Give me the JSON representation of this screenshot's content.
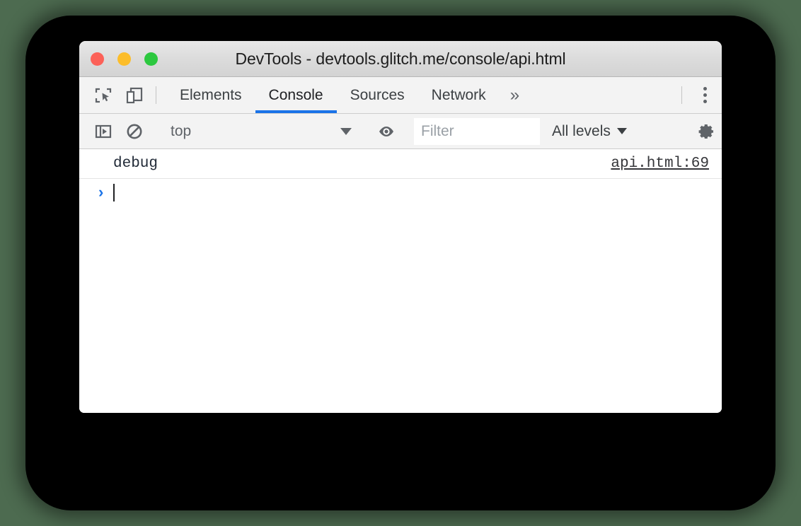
{
  "window": {
    "title": "DevTools - devtools.glitch.me/console/api.html",
    "traffic_lights": [
      {
        "name": "close",
        "color": "#fc6158"
      },
      {
        "name": "minimize",
        "color": "#fcbd2a"
      },
      {
        "name": "zoom",
        "color": "#2cc83f"
      }
    ]
  },
  "tabbar": {
    "inspect_icon": "inspect-element-icon",
    "device_icon": "device-toolbar-icon",
    "tabs": [
      {
        "label": "Elements",
        "active": false
      },
      {
        "label": "Console",
        "active": true
      },
      {
        "label": "Sources",
        "active": false
      },
      {
        "label": "Network",
        "active": false
      }
    ],
    "more_tabs_label": "»",
    "menu_icon": "more-options-icon",
    "active_tab_color": "#1a73e8"
  },
  "filterbar": {
    "sidebar_icon": "show-console-sidebar-icon",
    "clear_icon": "clear-console-icon",
    "context": "top",
    "eye_icon": "live-expression-eye-icon",
    "filter_placeholder": "Filter",
    "filter_value": "",
    "levels_label": "All levels",
    "settings_icon": "settings-gear-icon"
  },
  "console": {
    "messages": [
      {
        "text": "debug",
        "source": "api.html:69"
      }
    ],
    "prompt_symbol": "›",
    "prompt_value": ""
  }
}
